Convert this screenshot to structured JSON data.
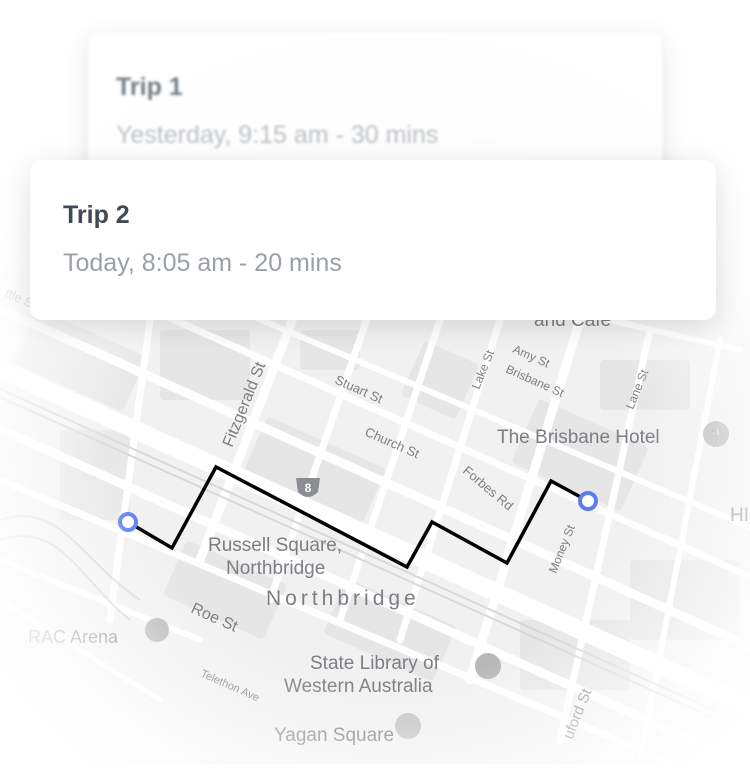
{
  "trips": [
    {
      "title": "Trip 1",
      "subtitle": "Yesterday, 9:15 am - 30 mins"
    },
    {
      "title": "Trip 2",
      "subtitle": "Today, 8:05 am - 20 mins"
    }
  ],
  "map": {
    "labels": {
      "fitzgerald": "Fitzgerald St",
      "stuart": "Stuart St",
      "church": "Church St",
      "lake": "Lake St",
      "amy": "Amy St",
      "brisbane_st": "Brisbane St",
      "lane": "Lane St",
      "forbes": "Forbes Rd",
      "money": "Money St",
      "brisbane_hotel": "The Brisbane Hotel",
      "cafe": "and Cafe",
      "russell1": "Russell Square,",
      "russell2": "Northbridge",
      "northbridge": "Northbridge",
      "rac": "RAC Arena",
      "roe": "Roe St",
      "library1": "State Library of",
      "library2": "Western Australia",
      "telethon": "Telethon Ave",
      "yagan": "Yagan Square",
      "route8": "8",
      "ttle": "ttle St",
      "edge_text": "HI",
      "william": "uford St"
    },
    "route_color": "#000000",
    "marker_color": "#5b7cf0"
  }
}
